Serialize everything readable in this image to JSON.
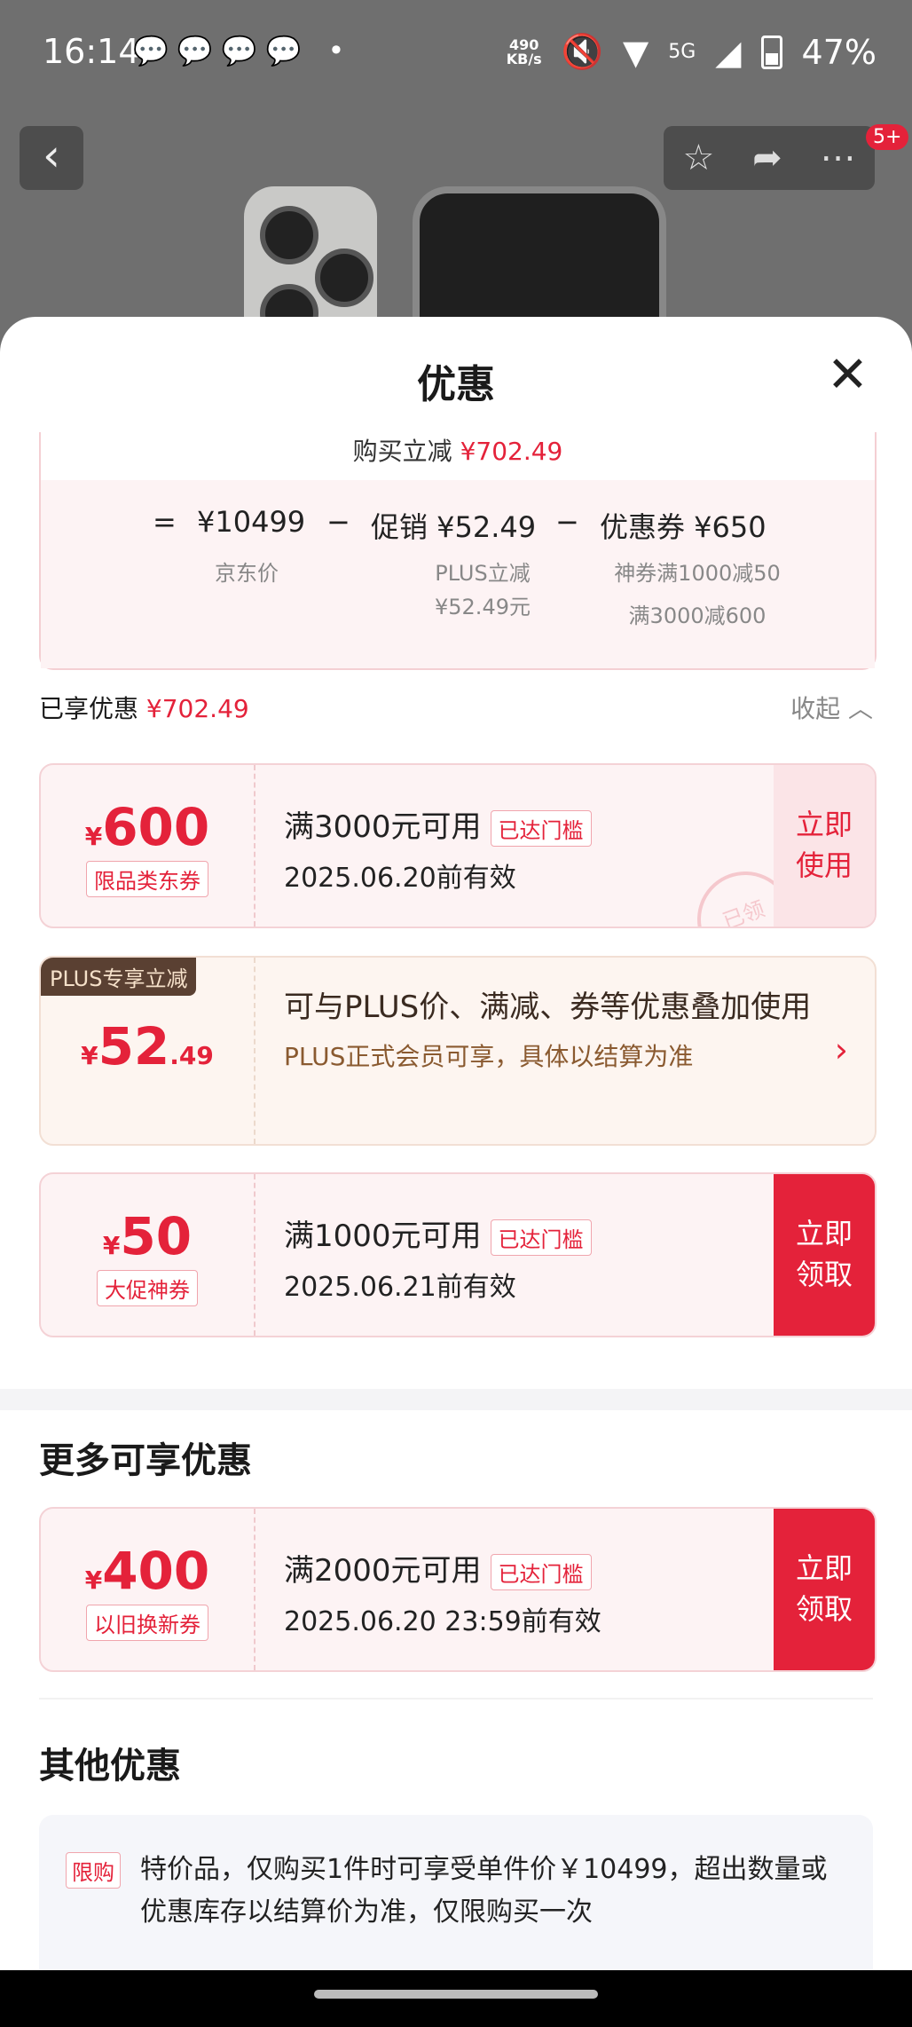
{
  "status": {
    "time": "16:14",
    "apps": "💬💬💬💬 •",
    "net_speed": "490",
    "net_unit": "KB/s",
    "signal": "5G",
    "battery": "47%"
  },
  "nav": {
    "back": "‹",
    "badge": "5+"
  },
  "sheet": {
    "title": "优惠",
    "close": "✕"
  },
  "calc": {
    "top_label": "购买立减",
    "top_value": "¥702.49",
    "eq": "=",
    "price": "¥10499",
    "minus1": "−",
    "promo": "促销 ¥52.49",
    "minus2": "−",
    "coupon": "优惠券 ¥650",
    "price_label": "京东价",
    "promo_label1": "PLUS立减",
    "promo_label2": "¥52.49元",
    "coupon_label1": "神券满1000减50",
    "coupon_label2": "满3000减600"
  },
  "enjoyed": {
    "label": "已享优惠",
    "value": "¥702.49",
    "fold": "收起 ︿"
  },
  "coupons": [
    {
      "currency": "¥",
      "amount": "600",
      "tag": "限品类东券",
      "cond": "满3000元可用",
      "reached": "已达门槛",
      "valid": "2025.06.20前有效",
      "btn1": "立即",
      "btn2": "使用",
      "stamp": "已领"
    },
    {
      "currency": "¥",
      "amount": "50",
      "tag": "大促神券",
      "cond": "满1000元可用",
      "reached": "已达门槛",
      "valid": "2025.06.21前有效",
      "btn1": "立即",
      "btn2": "领取"
    }
  ],
  "plus": {
    "ribbon": "PLUS专享立减",
    "currency": "¥",
    "amount": "52",
    "decimal": ".49",
    "desc": "可与PLUS价、满减、券等优惠叠加使用",
    "note": "PLUS正式会员可享，具体以结算为准",
    "chev": "›"
  },
  "more": {
    "title": "更多可享优惠",
    "coupon": {
      "currency": "¥",
      "amount": "400",
      "tag": "以旧换新券",
      "cond": "满2000元可用",
      "reached": "已达门槛",
      "valid": "2025.06.20 23:59前有效",
      "btn1": "立即",
      "btn2": "领取"
    }
  },
  "other": {
    "title": "其他优惠",
    "label": "限购",
    "text": "特价品，仅购买1件时可享受单件价￥10499，超出数量或优惠库存以结算价为准，仅限购买一次"
  }
}
